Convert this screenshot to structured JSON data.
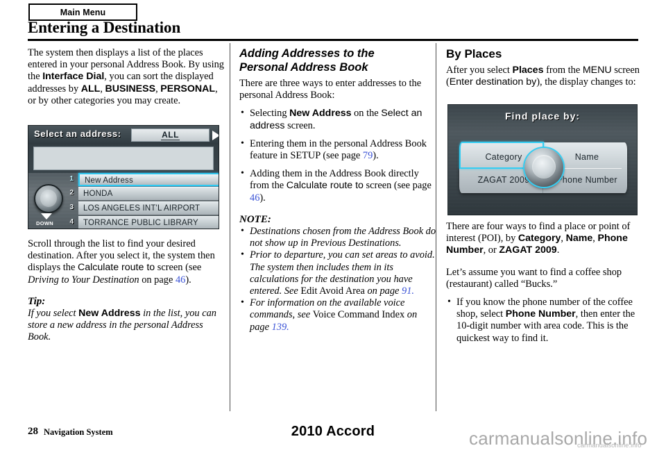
{
  "header": {
    "tab_label": "Main Menu",
    "title": "Entering a Destination"
  },
  "col1": {
    "intro_1": "The system then displays a list of the places entered in your personal Address Book. By using the ",
    "intro_bold_1": "Interface Dial",
    "intro_2": ", you can sort the displayed addresses by ",
    "intro_bold_2": "ALL",
    "intro_3": ", ",
    "intro_bold_3": "BUSINESS",
    "intro_4": ", ",
    "intro_bold_4": "PERSONAL",
    "intro_5": ", or by other categories you may create.",
    "nav_screen": {
      "title": "Select an address:",
      "filter_value": "ALL",
      "next_arrow": "right-arrow",
      "knob_label": "DOWN",
      "rows": [
        {
          "num": "1",
          "label": "New Address",
          "selected": true
        },
        {
          "num": "2",
          "label": "HONDA",
          "selected": false
        },
        {
          "num": "3",
          "label": "LOS ANGELES INT'L AIRPORT",
          "selected": false
        },
        {
          "num": "4",
          "label": "TORRANCE PUBLIC LIBRARY",
          "selected": false
        }
      ]
    },
    "scroll_1": "Scroll through the list to find your desired destination. After you select it, the system then displays the ",
    "scroll_bold": "Calculate route to",
    "scroll_2": " screen (see ",
    "scroll_ital": "Driving to Your Destination",
    "scroll_3": " on page ",
    "scroll_page": "46",
    "scroll_4": ").",
    "tip_head": "Tip:",
    "tip_1": "If you select ",
    "tip_bold": "New Address",
    "tip_2": " in the list, you can store a new address in the personal Address Book."
  },
  "col2": {
    "heading_line1": "Adding Addresses to the",
    "heading_line2": "Personal Address Book",
    "intro": "There are three ways to enter addresses to the personal Address Book:",
    "bullets": [
      {
        "pre": "Selecting ",
        "bold": "New Address",
        "mid": " on the ",
        "sans": "Select an address",
        "post": " screen."
      },
      {
        "pre": "Entering them in the personal Address Book feature in SETUP (see page ",
        "page": "79",
        "post": ")."
      },
      {
        "pre": "Adding them in the Address Book directly from the ",
        "sans": "Calculate route to",
        "mid": " screen (see page ",
        "page": "46",
        "post": ")."
      }
    ],
    "note_head": "NOTE:",
    "notes": [
      {
        "ital": "Destinations chosen from the Address Book do not show up in Previous Destinations."
      },
      {
        "ital_1": "Prior to departure, you can set areas to avoid. The system then includes them in its calculations for the destination you have entered. See ",
        "roman": "Edit Avoid Area",
        "ital_2": " on page ",
        "page": "91."
      },
      {
        "ital_1": "For information on the available voice commands, see ",
        "roman": "Voice Command Index",
        "ital_2": " on page ",
        "page": "139."
      }
    ]
  },
  "col3": {
    "heading": "By Places",
    "intro_1": "After you select ",
    "intro_bold": "Places",
    "intro_2": " from the ",
    "intro_sans_1": "MENU",
    "intro_3": " screen (",
    "intro_sans_2": "Enter destination by",
    "intro_4": "), the display changes to:",
    "nav_screen": {
      "title": "Find place by:",
      "cells": [
        {
          "label": "Category",
          "selected": true
        },
        {
          "label": "Name",
          "selected": false
        },
        {
          "label": "ZAGAT 2009",
          "selected": false
        },
        {
          "label": "Phone Number",
          "selected": false
        }
      ]
    },
    "ways_1": "There are four ways to find a place or point of interest (POI), by ",
    "ways_bold_1": "Category",
    "ways_2": ", ",
    "ways_bold_2": "Name",
    "ways_3": ", ",
    "ways_bold_3": "Phone Number",
    "ways_4": ", or ",
    "ways_bold_4": "ZAGAT 2009",
    "ways_5": ".",
    "assume": "Let’s assume you want to find a coffee shop (restaurant) called “Bucks.”",
    "bullet_1": "If you know the phone number of the coffee shop, select ",
    "bullet_bold": "Phone Number",
    "bullet_2": ", then enter the 10-digit number with area code. This is the quickest way to find it."
  },
  "footer": {
    "page_number": "28",
    "section": "Navigation System",
    "model": "2010 Accord",
    "watermark": "carmanualsonline.info",
    "watermark_small": "carmanualsonline.info"
  },
  "colors": {
    "page_ref": "#3a52d6",
    "nav_accent": "#35cdf2",
    "rule": "#000000"
  }
}
